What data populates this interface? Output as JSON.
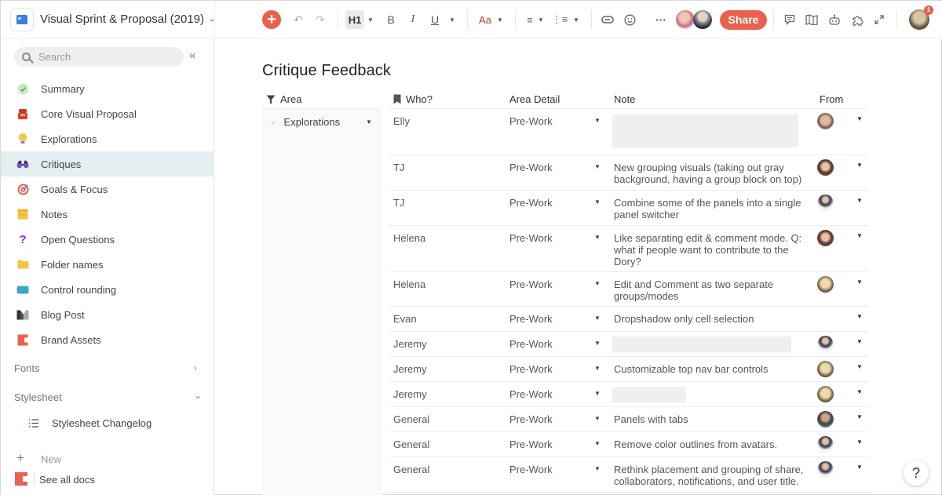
{
  "topbar": {
    "doc_title": "Visual Sprint & Proposal (2019)",
    "heading_label": "H1",
    "bold": "B",
    "italic": "I",
    "underline": "U",
    "text_style": "Aa",
    "more": "···",
    "share_label": "Share",
    "notification_count": "1"
  },
  "sidebar": {
    "search_placeholder": "Search",
    "collapse": "«",
    "items": [
      {
        "label": "Summary",
        "icon": "check-circle-icon"
      },
      {
        "label": "Core Visual Proposal",
        "icon": "jewelry-box-icon"
      },
      {
        "label": "Explorations",
        "icon": "lightbulb-icon"
      },
      {
        "label": "Critiques",
        "icon": "binoculars-icon",
        "active": true
      },
      {
        "label": "Goals & Focus",
        "icon": "target-icon"
      },
      {
        "label": "Notes",
        "icon": "sticky-note-icon"
      },
      {
        "label": "Open Questions",
        "icon": "question-icon"
      },
      {
        "label": "Folder names",
        "icon": "folder-icon"
      },
      {
        "label": "Control rounding",
        "icon": "rounded-rect-icon"
      },
      {
        "label": "Blog Post",
        "icon": "medium-icon"
      },
      {
        "label": "Brand Assets",
        "icon": "coda-icon"
      }
    ],
    "sections": {
      "fonts": "Fonts",
      "stylesheet": "Stylesheet",
      "stylesheet_child": "Stylesheet Changelog"
    },
    "new_label": "New",
    "see_all_label": "See all docs"
  },
  "main": {
    "title": "Critique Feedback",
    "columns": {
      "area": "Area",
      "who": "Who?",
      "area_detail": "Area Detail",
      "note": "Note",
      "from": "From"
    },
    "group": "Explorations",
    "rows": [
      {
        "who": "Elly",
        "area_detail": "Pre-Work",
        "note": "",
        "redacted": true,
        "from": true
      },
      {
        "who": "TJ",
        "area_detail": "Pre-Work",
        "note": "New grouping visuals (taking out gray background, having a group block on top)",
        "from": true
      },
      {
        "who": "TJ",
        "area_detail": "Pre-Work",
        "note": "Combine  some of the panels into a single panel switcher",
        "from": true
      },
      {
        "who": "Helena",
        "area_detail": "Pre-Work",
        "note": "Like separating edit & comment mode. Q: what if people want to contribute to the Dory?",
        "from": true
      },
      {
        "who": "Helena",
        "area_detail": "Pre-Work",
        "note": "Edit and Comment as two separate groups/modes",
        "from": true
      },
      {
        "who": "Evan",
        "area_detail": "Pre-Work",
        "note": "Dropshadow only cell selection",
        "from": false
      },
      {
        "who": "Jeremy",
        "area_detail": "Pre-Work",
        "note": "",
        "redacted": true,
        "from": true
      },
      {
        "who": "Jeremy",
        "area_detail": "Pre-Work",
        "note": "Customizable top nav bar controls",
        "from": true
      },
      {
        "who": "Jeremy",
        "area_detail": "Pre-Work",
        "note": "",
        "redacted": true,
        "from": true
      },
      {
        "who": "General",
        "area_detail": "Pre-Work",
        "note": "Panels with tabs",
        "from": true
      },
      {
        "who": "General",
        "area_detail": "Pre-Work",
        "note": "Remove color outlines from avatars.",
        "from": true
      },
      {
        "who": "General",
        "area_detail": "Pre-Work",
        "note": "Rethink placement and grouping of share, collaborators, notifications, and user title.",
        "from": true
      }
    ]
  },
  "help_label": "?",
  "colors": {
    "accent": "#e8614c",
    "active_nav": "#e3eff1"
  }
}
